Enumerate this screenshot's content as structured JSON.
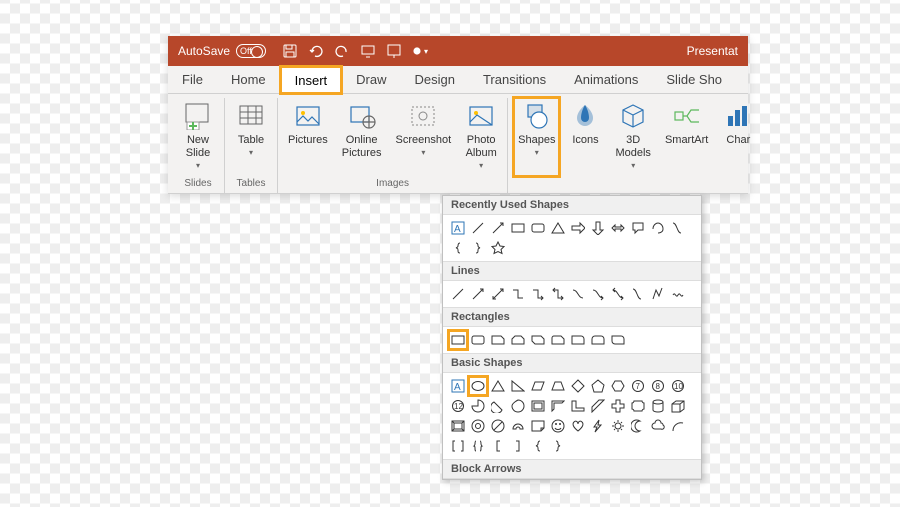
{
  "titlebar": {
    "autosave_label": "AutoSave",
    "toggle_state": "Off",
    "doc_title": "Presentat"
  },
  "tabs": [
    "File",
    "Home",
    "Insert",
    "Draw",
    "Design",
    "Transitions",
    "Animations",
    "Slide Sho"
  ],
  "ribbon": {
    "groups": [
      {
        "label": "Slides",
        "items": [
          {
            "label": "New\nSlide",
            "caret": true
          }
        ]
      },
      {
        "label": "Tables",
        "items": [
          {
            "label": "Table",
            "caret": true
          }
        ]
      },
      {
        "label": "Images",
        "items": [
          {
            "label": "Pictures"
          },
          {
            "label": "Online\nPictures"
          },
          {
            "label": "Screenshot",
            "caret": true
          },
          {
            "label": "Photo\nAlbum",
            "caret": true
          }
        ]
      },
      {
        "label": "",
        "items": [
          {
            "label": "Shapes",
            "caret": true,
            "highlight": true
          },
          {
            "label": "Icons"
          },
          {
            "label": "3D\nModels",
            "caret": true
          },
          {
            "label": "SmartArt"
          },
          {
            "label": "Char"
          }
        ]
      }
    ]
  },
  "dropdown": {
    "sections": [
      {
        "title": "Recently Used Shapes"
      },
      {
        "title": "Lines"
      },
      {
        "title": "Rectangles"
      },
      {
        "title": "Basic Shapes"
      },
      {
        "title": "Block Arrows"
      }
    ]
  }
}
